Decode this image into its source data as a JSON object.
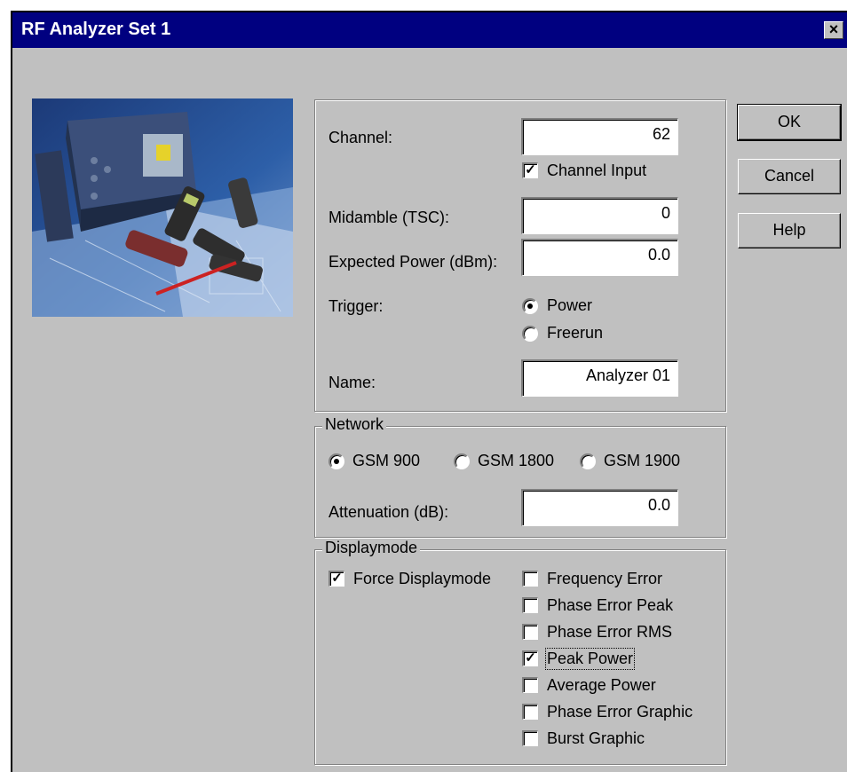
{
  "window": {
    "title": "RF Analyzer Set 1",
    "close_label": "×"
  },
  "settings": {
    "channel_label": "Channel:",
    "channel_value": "62",
    "channel_input_label": "Channel Input",
    "channel_input_checked": true,
    "midamble_label": "Midamble (TSC):",
    "midamble_value": "0",
    "expected_power_label": "Expected Power (dBm):",
    "expected_power_value": "0.0",
    "trigger_label": "Trigger:",
    "trigger_options": [
      "Power",
      "Freerun"
    ],
    "trigger_selected": "Power",
    "name_label": "Name:",
    "name_value": "Analyzer 01"
  },
  "network": {
    "legend": "Network",
    "options": [
      "GSM 900",
      "GSM 1800",
      "GSM 1900"
    ],
    "selected": "GSM 900",
    "attenuation_label": "Attenuation (dB):",
    "attenuation_value": "0.0"
  },
  "displaymode": {
    "legend": "Displaymode",
    "force_label": "Force Displaymode",
    "force_checked": true,
    "items": [
      {
        "label": "Frequency Error",
        "checked": false
      },
      {
        "label": "Phase Error Peak",
        "checked": false
      },
      {
        "label": "Phase Error RMS",
        "checked": false
      },
      {
        "label": "Peak Power",
        "checked": true
      },
      {
        "label": "Average Power",
        "checked": false
      },
      {
        "label": "Phase Error Graphic",
        "checked": false
      },
      {
        "label": "Burst Graphic",
        "checked": false
      }
    ]
  },
  "buttons": {
    "ok": "OK",
    "cancel": "Cancel",
    "help": "Help"
  }
}
